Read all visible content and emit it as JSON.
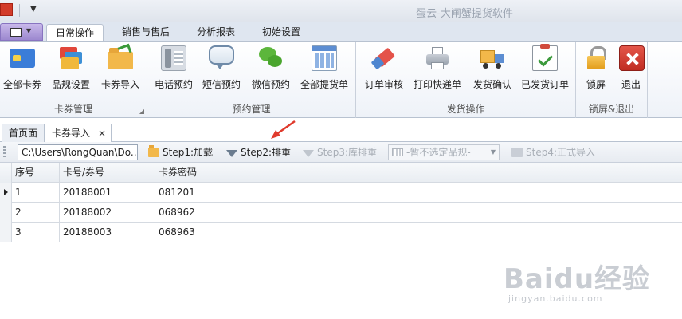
{
  "window": {
    "title": "蛋云-大闸蟹提货软件"
  },
  "ribbon": {
    "tabs": [
      {
        "label": "日常操作",
        "active": true
      },
      {
        "label": "销售与售后",
        "active": false
      },
      {
        "label": "分析报表",
        "active": false
      },
      {
        "label": "初始设置",
        "active": false
      }
    ],
    "groups": [
      {
        "label": "卡券管理",
        "buttons": [
          {
            "label": "全部卡券",
            "icon": "card-icon"
          },
          {
            "label": "品规设置",
            "icon": "cards-icon"
          },
          {
            "label": "卡券导入",
            "icon": "folder-import-icon"
          }
        ]
      },
      {
        "label": "预约管理",
        "buttons": [
          {
            "label": "电话预约",
            "icon": "phone-icon"
          },
          {
            "label": "短信预约",
            "icon": "message-bubble-icon"
          },
          {
            "label": "微信预约",
            "icon": "wechat-icon"
          },
          {
            "label": "全部提货单",
            "icon": "grid-list-icon"
          }
        ]
      },
      {
        "label": "发货操作",
        "buttons": [
          {
            "label": "订单审核",
            "icon": "eraser-icon"
          },
          {
            "label": "打印快递单",
            "icon": "printer-icon"
          },
          {
            "label": "发货确认",
            "icon": "delivery-truck-icon"
          },
          {
            "label": "已发货订单",
            "icon": "clipboard-check-icon"
          }
        ]
      },
      {
        "label": "锁屏&退出",
        "buttons": [
          {
            "label": "锁屏",
            "icon": "lock-icon"
          },
          {
            "label": "退出",
            "icon": "exit-icon"
          }
        ]
      }
    ]
  },
  "doc_tabs": [
    {
      "label": "首页面",
      "active": false
    },
    {
      "label": "卡券导入",
      "active": true,
      "closable": true,
      "close_glyph": "×"
    }
  ],
  "toolbar": {
    "path_value": "C:\\Users\\RongQuan\\Do...",
    "step1_label": "Step1:加载",
    "step2_label": "Step2:排重",
    "step3_label": "Step3:库排重",
    "combo_value": "-暂不选定品规-",
    "step4_label": "Step4:正式导入"
  },
  "grid": {
    "columns": [
      "序号",
      "卡号/券号",
      "卡券密码"
    ],
    "rows": [
      [
        "1",
        "20188001",
        "081201"
      ],
      [
        "2",
        "20188002",
        "068962"
      ],
      [
        "3",
        "20188003",
        "068963"
      ]
    ],
    "selected_row": 0
  },
  "watermark": {
    "logo_text": "Baidu经验",
    "url_text": "jingyan.baidu.com"
  },
  "colors": {
    "accent": "#3b7dd8",
    "annotation_arrow": "#e03a2c"
  }
}
